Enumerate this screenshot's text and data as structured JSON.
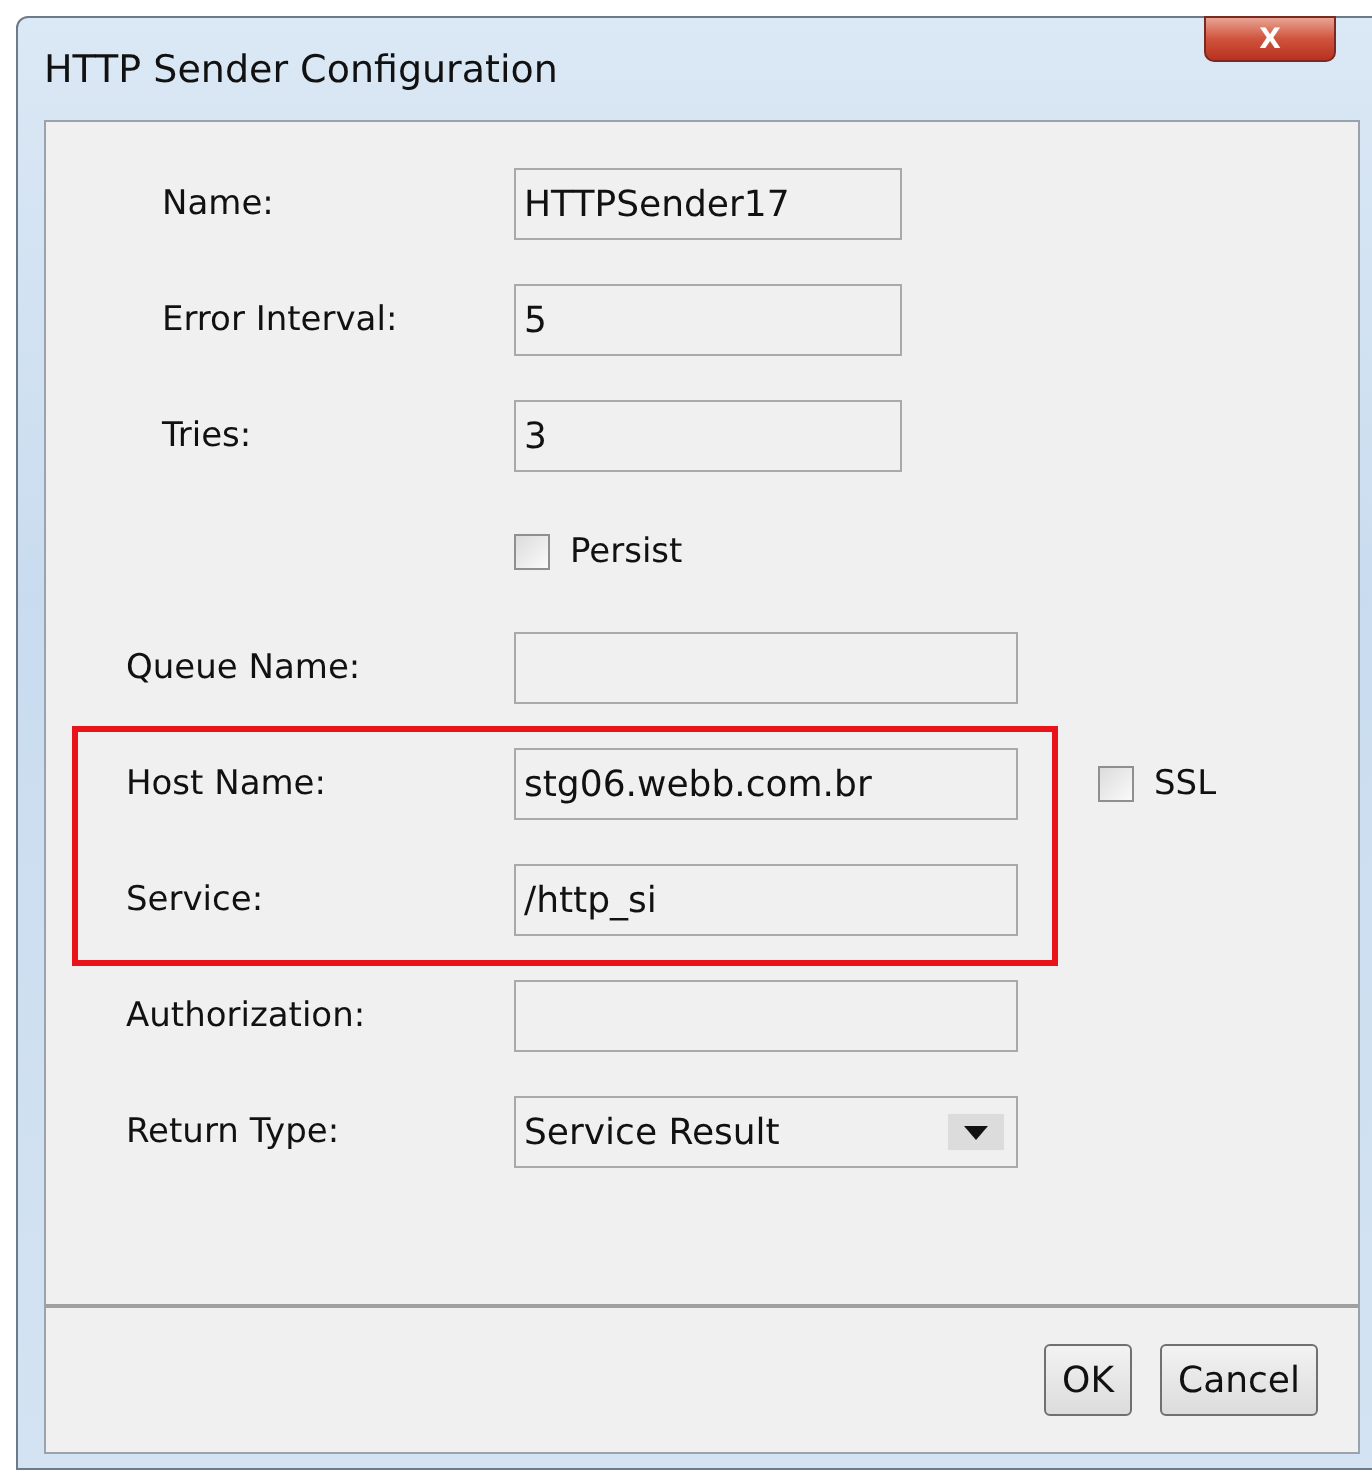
{
  "window": {
    "title": "HTTP Sender Configuration",
    "close_label": "X"
  },
  "rows": [
    {
      "kind": "short_text",
      "label": "Name:",
      "value": "HTTPSender17",
      "highlighted": false
    },
    {
      "kind": "short_text",
      "label": "Error Interval:",
      "value": "5",
      "highlighted": false
    },
    {
      "kind": "short_text",
      "label": "Tries:",
      "value": "3",
      "highlighted": false
    },
    {
      "kind": "checkbox",
      "label": "Persist",
      "checked": false,
      "highlighted": false
    },
    {
      "kind": "text",
      "label": "Queue Name:",
      "highlighted": false
    },
    {
      "kind": "text",
      "label": "Host Name:",
      "value": "stg06.webb.com.br",
      "highlighted": true,
      "option": {
        "label": "SSL",
        "checked": false
      }
    },
    {
      "kind": "text",
      "label": "Service:",
      "value": "/http_si",
      "highlighted": true
    },
    {
      "kind": "text",
      "label": "Authorization:",
      "highlighted": false
    },
    {
      "kind": "select",
      "label": "Return Type:",
      "value": "Service Result",
      "highlighted": false
    }
  ],
  "buttons": [
    "OK",
    "Cancel"
  ]
}
